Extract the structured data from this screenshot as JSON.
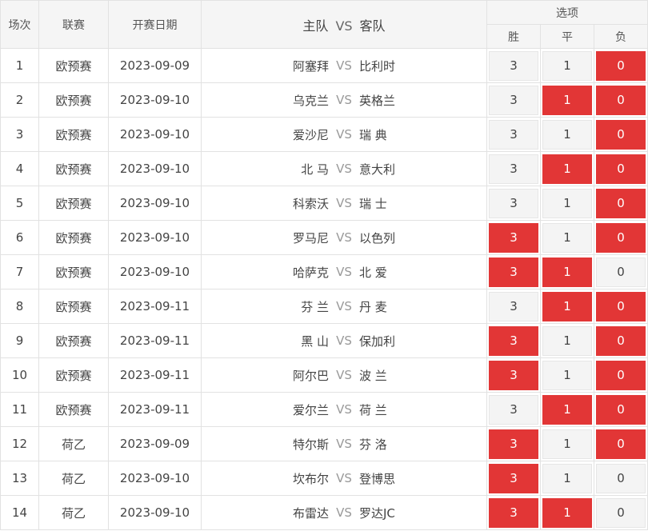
{
  "header": {
    "col_index": "场次",
    "col_league": "联赛",
    "col_date": "开赛日期",
    "home": "主队",
    "vs": "VS",
    "away": "客队",
    "options_group": "选项",
    "opt_win": "胜",
    "opt_draw": "平",
    "opt_lose": "负"
  },
  "colors": {
    "selected": "#e23636",
    "unselected": "#f4f4f4"
  },
  "rows": [
    {
      "no": "1",
      "league": "欧预赛",
      "date": "2023-09-09",
      "home": "阿塞拜",
      "vs": "VS",
      "away": "比利时",
      "win": "3",
      "draw": "1",
      "lose": "0",
      "win_sel": false,
      "draw_sel": false,
      "lose_sel": true
    },
    {
      "no": "2",
      "league": "欧预赛",
      "date": "2023-09-10",
      "home": "乌克兰",
      "vs": "VS",
      "away": "英格兰",
      "win": "3",
      "draw": "1",
      "lose": "0",
      "win_sel": false,
      "draw_sel": true,
      "lose_sel": true
    },
    {
      "no": "3",
      "league": "欧预赛",
      "date": "2023-09-10",
      "home": "爱沙尼",
      "vs": "VS",
      "away": "瑞 典",
      "win": "3",
      "draw": "1",
      "lose": "0",
      "win_sel": false,
      "draw_sel": false,
      "lose_sel": true
    },
    {
      "no": "4",
      "league": "欧预赛",
      "date": "2023-09-10",
      "home": "北 马",
      "vs": "VS",
      "away": "意大利",
      "win": "3",
      "draw": "1",
      "lose": "0",
      "win_sel": false,
      "draw_sel": true,
      "lose_sel": true
    },
    {
      "no": "5",
      "league": "欧预赛",
      "date": "2023-09-10",
      "home": "科索沃",
      "vs": "VS",
      "away": "瑞 士",
      "win": "3",
      "draw": "1",
      "lose": "0",
      "win_sel": false,
      "draw_sel": false,
      "lose_sel": true
    },
    {
      "no": "6",
      "league": "欧预赛",
      "date": "2023-09-10",
      "home": "罗马尼",
      "vs": "VS",
      "away": "以色列",
      "win": "3",
      "draw": "1",
      "lose": "0",
      "win_sel": true,
      "draw_sel": false,
      "lose_sel": true
    },
    {
      "no": "7",
      "league": "欧预赛",
      "date": "2023-09-10",
      "home": "哈萨克",
      "vs": "VS",
      "away": "北 爱",
      "win": "3",
      "draw": "1",
      "lose": "0",
      "win_sel": true,
      "draw_sel": true,
      "lose_sel": false
    },
    {
      "no": "8",
      "league": "欧预赛",
      "date": "2023-09-11",
      "home": "芬 兰",
      "vs": "VS",
      "away": "丹 麦",
      "win": "3",
      "draw": "1",
      "lose": "0",
      "win_sel": false,
      "draw_sel": true,
      "lose_sel": true
    },
    {
      "no": "9",
      "league": "欧预赛",
      "date": "2023-09-11",
      "home": "黑 山",
      "vs": "VS",
      "away": "保加利",
      "win": "3",
      "draw": "1",
      "lose": "0",
      "win_sel": true,
      "draw_sel": false,
      "lose_sel": true
    },
    {
      "no": "10",
      "league": "欧预赛",
      "date": "2023-09-11",
      "home": "阿尔巴",
      "vs": "VS",
      "away": "波 兰",
      "win": "3",
      "draw": "1",
      "lose": "0",
      "win_sel": true,
      "draw_sel": false,
      "lose_sel": true
    },
    {
      "no": "11",
      "league": "欧预赛",
      "date": "2023-09-11",
      "home": "爱尔兰",
      "vs": "VS",
      "away": "荷 兰",
      "win": "3",
      "draw": "1",
      "lose": "0",
      "win_sel": false,
      "draw_sel": true,
      "lose_sel": true
    },
    {
      "no": "12",
      "league": "荷乙",
      "date": "2023-09-09",
      "home": "特尔斯",
      "vs": "VS",
      "away": "芬 洛",
      "win": "3",
      "draw": "1",
      "lose": "0",
      "win_sel": true,
      "draw_sel": false,
      "lose_sel": true
    },
    {
      "no": "13",
      "league": "荷乙",
      "date": "2023-09-10",
      "home": "坎布尔",
      "vs": "VS",
      "away": "登博思",
      "win": "3",
      "draw": "1",
      "lose": "0",
      "win_sel": true,
      "draw_sel": false,
      "lose_sel": false
    },
    {
      "no": "14",
      "league": "荷乙",
      "date": "2023-09-10",
      "home": "布雷达",
      "vs": "VS",
      "away": "罗达JC",
      "win": "3",
      "draw": "1",
      "lose": "0",
      "win_sel": true,
      "draw_sel": true,
      "lose_sel": false
    }
  ]
}
